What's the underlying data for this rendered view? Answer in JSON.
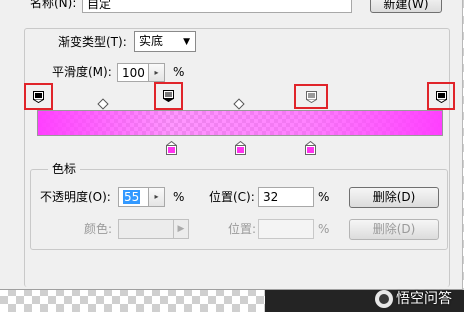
{
  "window": {
    "name_label": "名称(N):",
    "name_value": "自定",
    "new_button": "新建(W)"
  },
  "gradient": {
    "type_label": "渐变类型(T):",
    "type_value": "实底",
    "smoothness_label": "平滑度(M):",
    "smoothness_value": "100",
    "smoothness_unit": "%",
    "opacity_stop_positions_percent": [
      0,
      32,
      67,
      100
    ],
    "color_stop_positions_percent": [
      33,
      50,
      67
    ],
    "highlight_color": "#e0242a",
    "bar_color": "#ff3cff"
  },
  "stops": {
    "group_title": "色标",
    "opacity_label": "不透明度(O):",
    "opacity_value": "55",
    "opacity_unit": "%",
    "location_label": "位置(C):",
    "location_value": "32",
    "location_unit": "%",
    "delete_button": "删除(D)",
    "color_label": "颜色:",
    "color_location_label": "位置:",
    "color_location_unit": "%",
    "color_delete_button": "删除(D)"
  },
  "watermark": {
    "text": "悟空问答"
  }
}
